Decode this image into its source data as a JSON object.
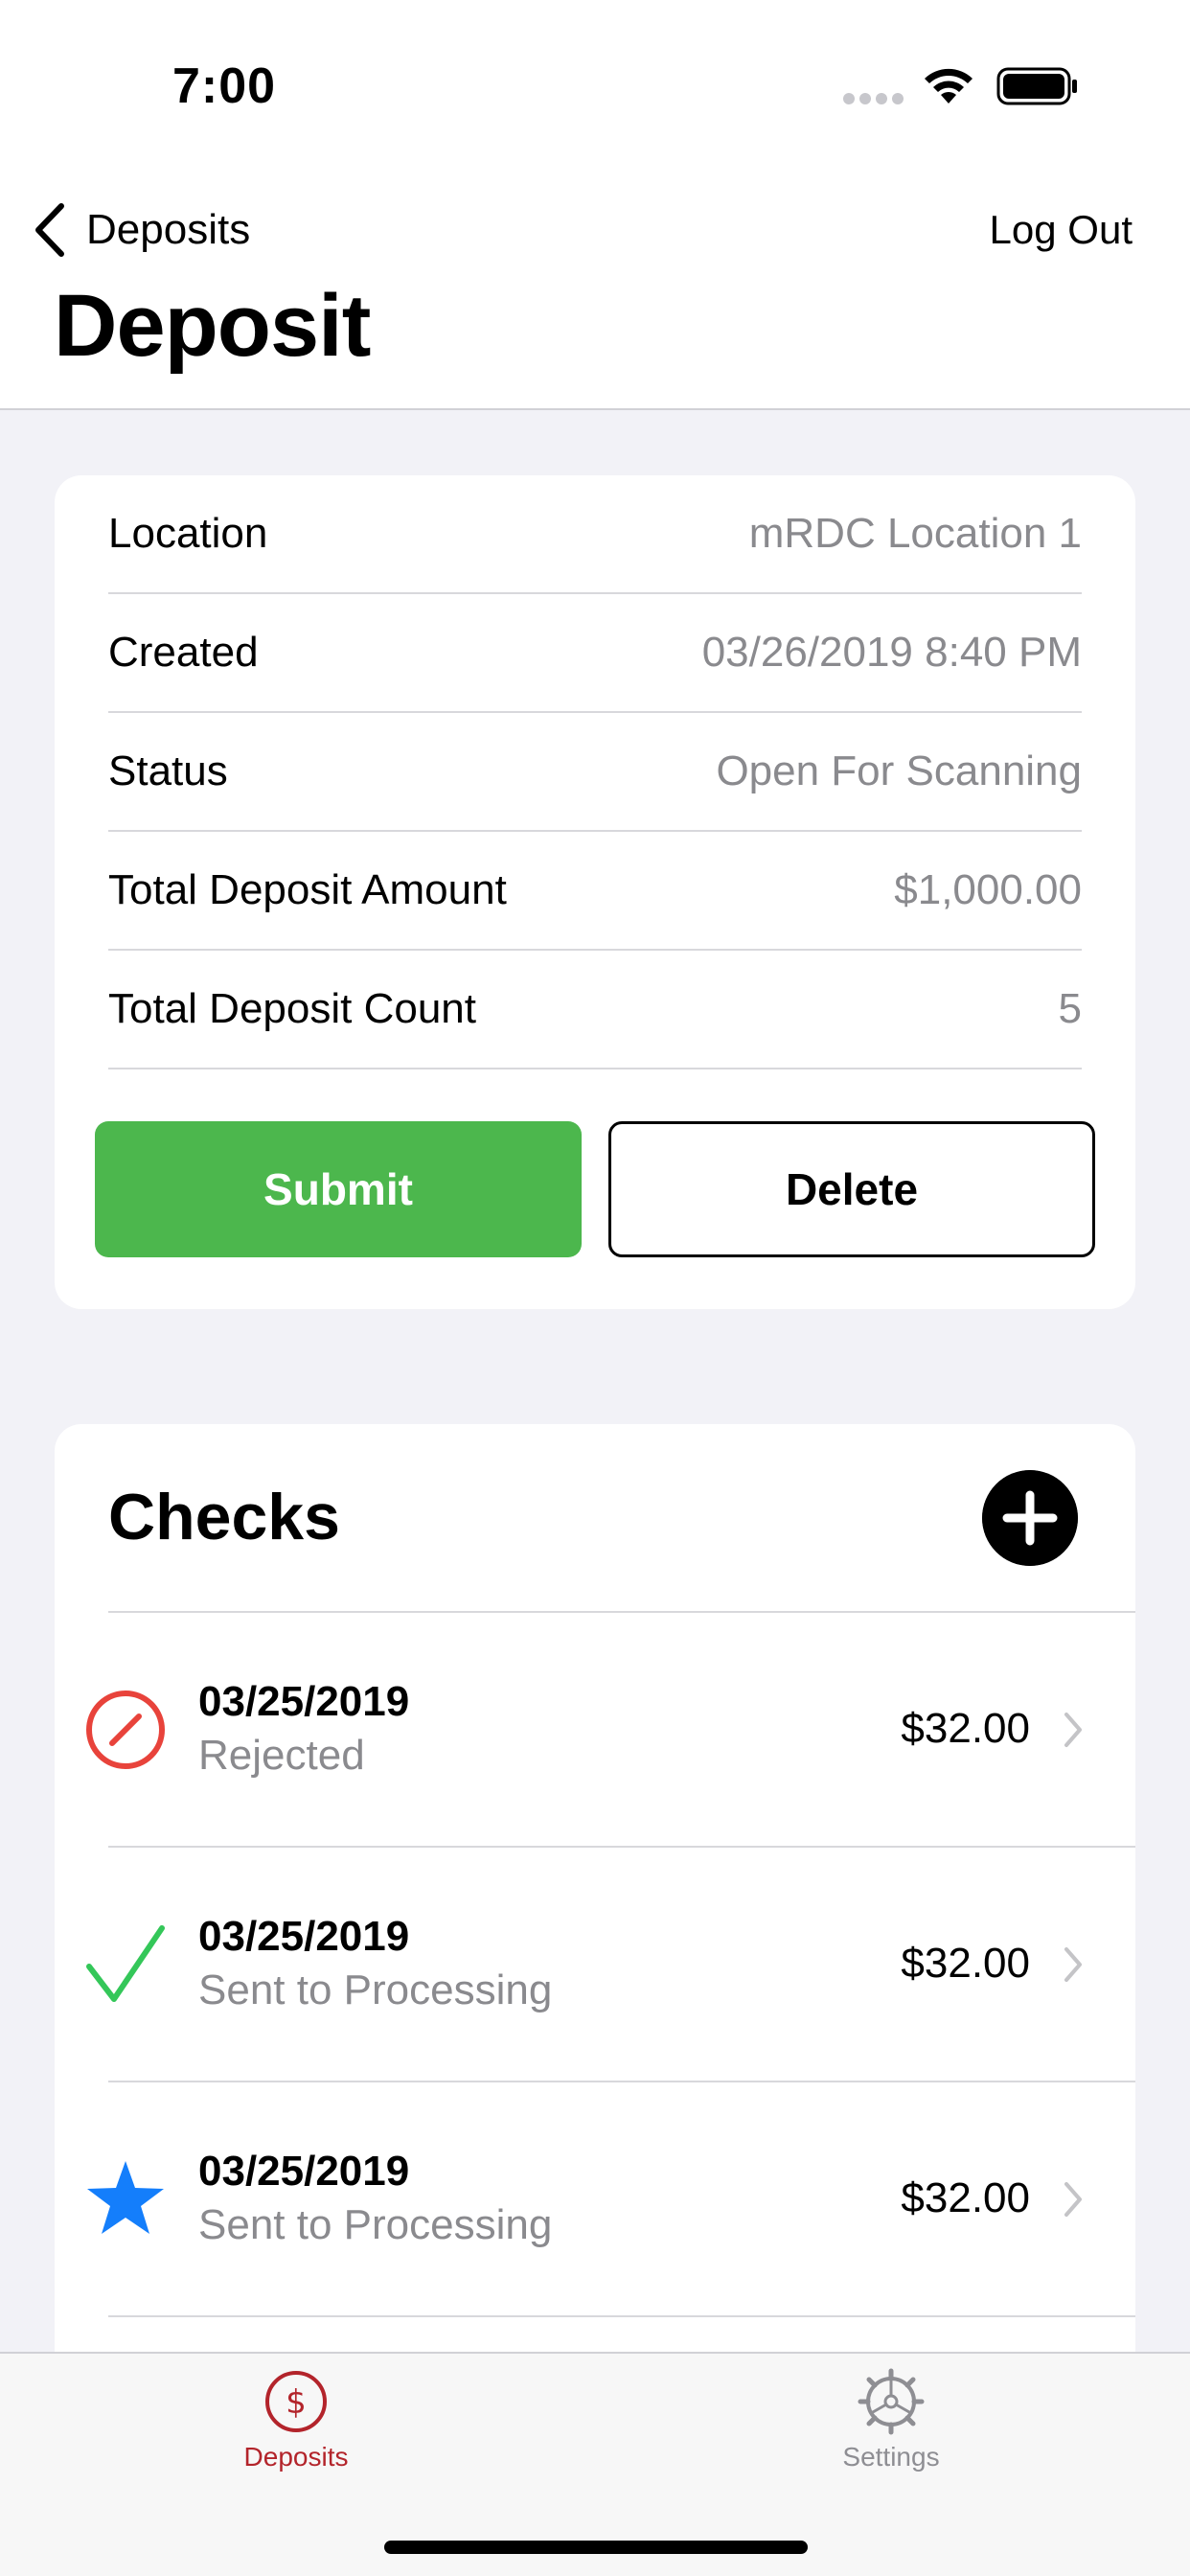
{
  "status_bar": {
    "time": "7:00"
  },
  "nav": {
    "back_label": "Deposits",
    "logout_label": "Log Out",
    "title": "Deposit"
  },
  "details": {
    "rows": [
      {
        "label": "Location",
        "value": "mRDC Location 1"
      },
      {
        "label": "Created",
        "value": "03/26/2019 8:40 PM"
      },
      {
        "label": "Status",
        "value": "Open For Scanning"
      },
      {
        "label": "Total Deposit Amount",
        "value": "$1,000.00"
      },
      {
        "label": "Total Deposit Count",
        "value": "5"
      }
    ],
    "submit_label": "Submit",
    "delete_label": "Delete"
  },
  "checks": {
    "title": "Checks",
    "items": [
      {
        "date": "03/25/2019",
        "status": "Rejected",
        "amount": "$32.00",
        "icon": "rejected-icon"
      },
      {
        "date": "03/25/2019",
        "status": "Sent to Processing",
        "amount": "$32.00",
        "icon": "checkmark-icon"
      },
      {
        "date": "03/25/2019",
        "status": "Sent to Processing",
        "amount": "$32.00",
        "icon": "star-icon"
      }
    ]
  },
  "tab_bar": {
    "tabs": [
      {
        "label": "Deposits",
        "icon": "dollar-circle-icon",
        "selected": true
      },
      {
        "label": "Settings",
        "icon": "gear-icon",
        "selected": false
      }
    ]
  },
  "colors": {
    "submit": "#4cb74d",
    "rejected": "#e8433b",
    "processing": "#34c759",
    "star": "#147efb",
    "tab_active": "#b3242b",
    "tab_inactive": "#8e8e93"
  }
}
